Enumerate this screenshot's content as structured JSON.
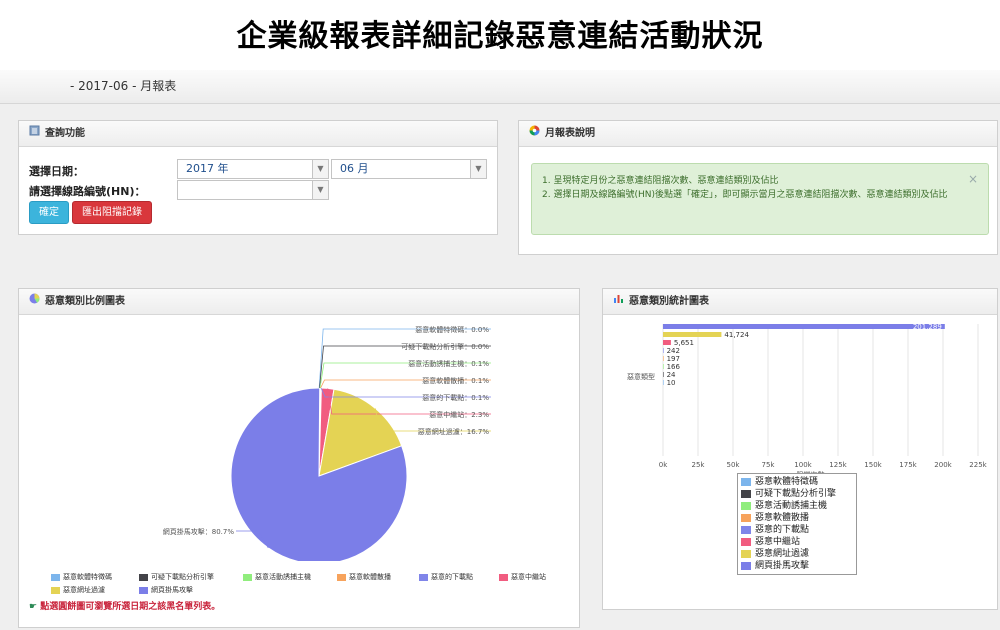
{
  "page_title": "企業級報表詳細記錄惡意連結活動狀況",
  "breadcrumb": "- 2017-06 - 月報表",
  "query_panel": {
    "title": "查詢功能",
    "date_label": "選擇日期：",
    "year_value": "2017 年",
    "month_value": "06 月",
    "line_label": "請選擇線路編號(HN)：",
    "line_value": "",
    "confirm_label": "確定",
    "export_label": "匯出阻擋記錄"
  },
  "help_panel": {
    "title": "月報表說明",
    "line1": "1. 呈現特定月份之惡意連結阻擋次數、惡意連結類別及佔比",
    "line2": "2. 選擇日期及線路編號(HN)後點選「確定」，即可顯示當月之惡意連結阻擋次數、惡意連結類別及佔比",
    "close": "×"
  },
  "pie_panel": {
    "title": "惡意類別比例圖表",
    "note": "點選圓餅圖可瀏覽所選日期之該黑名單列表。"
  },
  "bar_panel": {
    "title": "惡意類別統計圖表"
  },
  "colors": {
    "c1": "#7cb5ec",
    "c2": "#434348",
    "c3": "#90ed7d",
    "c4": "#f7a35c",
    "c5": "#8085e9",
    "c6": "#f15c80",
    "c7": "#e4d354",
    "c8": "#7b7ee8",
    "alert_bg": "#dff0d8"
  },
  "chart_data": [
    {
      "type": "pie",
      "series": [
        {
          "name": "惡意軟體特徵碼",
          "value": 0.0,
          "label": "惡意軟體特徵碼：0.0%",
          "color": "#7cb5ec"
        },
        {
          "name": "可疑下載點分析引擎",
          "value": 0.0,
          "label": "可疑下載點分析引擎：0.0%",
          "color": "#434348"
        },
        {
          "name": "惡意活動誘捕主機",
          "value": 0.1,
          "label": "惡意活動誘捕主機：0.1%",
          "color": "#90ed7d"
        },
        {
          "name": "惡意軟體散播",
          "value": 0.1,
          "label": "惡意軟體散播：0.1%",
          "color": "#f7a35c"
        },
        {
          "name": "惡意的下載點",
          "value": 0.1,
          "label": "惡意的下載點：0.1%",
          "color": "#8085e9"
        },
        {
          "name": "惡意中繼站",
          "value": 2.3,
          "label": "惡意中繼站：2.3%",
          "color": "#f15c80"
        },
        {
          "name": "惡意網址過濾",
          "value": 16.7,
          "label": "惡意網址過濾：16.7%",
          "color": "#e4d354"
        },
        {
          "name": "網頁掛馬攻擊",
          "value": 80.7,
          "label": "網頁掛馬攻擊：80.7%",
          "color": "#7b7ee8"
        }
      ]
    },
    {
      "type": "bar",
      "orientation": "horizontal",
      "category": "惡意類型",
      "xlabel": "阻擋次數",
      "xlim": [
        0,
        225000
      ],
      "ticks": [
        "0k",
        "25k",
        "50k",
        "75k",
        "100k",
        "125k",
        "150k",
        "175k",
        "200k",
        "225k"
      ],
      "series": [
        {
          "name": "網頁掛馬攻擊",
          "value": 201289,
          "label": "201,289",
          "color": "#7b7ee8"
        },
        {
          "name": "惡意網址過濾",
          "value": 41724,
          "label": "41,724",
          "color": "#e4d354"
        },
        {
          "name": "惡意中繼站",
          "value": 5651,
          "label": "5,651",
          "color": "#f15c80"
        },
        {
          "name": "惡意的下載點",
          "value": 242,
          "label": "242",
          "color": "#8085e9"
        },
        {
          "name": "惡意軟體散播",
          "value": 197,
          "label": "197",
          "color": "#f7a35c"
        },
        {
          "name": "惡意活動誘捕主機",
          "value": 166,
          "label": "166",
          "color": "#90ed7d"
        },
        {
          "name": "可疑下載點分析引擎",
          "value": 24,
          "label": "24",
          "color": "#434348"
        },
        {
          "name": "惡意軟體特徵碼",
          "value": 10,
          "label": "10",
          "color": "#7cb5ec"
        }
      ],
      "legend": [
        "惡意軟體特徵碼",
        "可疑下載點分析引擎",
        "惡意活動誘捕主機",
        "惡意軟體散播",
        "惡意的下載點",
        "惡意中繼站",
        "惡意網址過濾",
        "網頁掛馬攻擊"
      ]
    }
  ]
}
